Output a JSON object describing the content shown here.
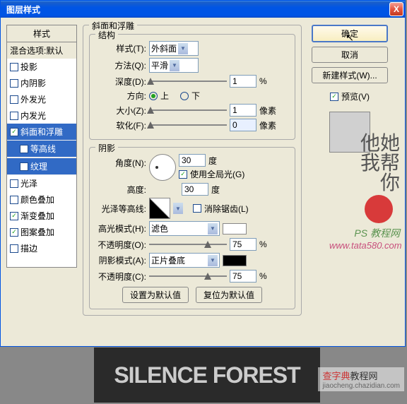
{
  "title": "图层样式",
  "close_x": "X",
  "left": {
    "header": "样式",
    "blend": "混合选项:默认",
    "items": [
      {
        "label": "投影",
        "checked": false,
        "sel": false
      },
      {
        "label": "内阴影",
        "checked": false,
        "sel": false
      },
      {
        "label": "外发光",
        "checked": false,
        "sel": false
      },
      {
        "label": "内发光",
        "checked": false,
        "sel": false
      },
      {
        "label": "斜面和浮雕",
        "checked": true,
        "sel": true
      },
      {
        "label": "等高线",
        "checked": false,
        "sel": false,
        "sub": true,
        "selbg": true
      },
      {
        "label": "纹理",
        "checked": false,
        "sel": false,
        "sub": true,
        "selbg": true
      },
      {
        "label": "光泽",
        "checked": false,
        "sel": false
      },
      {
        "label": "颜色叠加",
        "checked": false,
        "sel": false
      },
      {
        "label": "渐变叠加",
        "checked": true,
        "sel": false
      },
      {
        "label": "图案叠加",
        "checked": true,
        "sel": false
      },
      {
        "label": "描边",
        "checked": false,
        "sel": false
      }
    ]
  },
  "bevel": {
    "section_title": "斜面和浮雕",
    "structure": "结构",
    "style_label": "样式(T):",
    "style_value": "外斜面",
    "technique_label": "方法(Q):",
    "technique_value": "平滑",
    "depth_label": "深度(D):",
    "depth_value": "1",
    "depth_unit": "%",
    "direction_label": "方向:",
    "dir_up": "上",
    "dir_down": "下",
    "size_label": "大小(Z):",
    "size_value": "1",
    "size_unit": "像素",
    "soften_label": "软化(F):",
    "soften_value": "0",
    "soften_unit": "像素"
  },
  "shadow": {
    "section_title": "阴影",
    "angle_label": "角度(N):",
    "angle_value": "30",
    "angle_unit": "度",
    "global_light": "使用全局光(G)",
    "altitude_label": "高度:",
    "altitude_value": "30",
    "altitude_unit": "度",
    "gloss_label": "光泽等高线:",
    "antialias": "消除锯齿(L)",
    "highlight_mode_label": "高光模式(H):",
    "highlight_mode_value": "滤色",
    "hl_opacity_label": "不透明度(O):",
    "hl_opacity_value": "75",
    "hl_opacity_unit": "%",
    "shadow_mode_label": "阴影模式(A):",
    "shadow_mode_value": "正片叠底",
    "sh_opacity_label": "不透明度(C):",
    "sh_opacity_value": "75",
    "sh_opacity_unit": "%",
    "set_default": "设置为默认值",
    "reset_default": "复位为默认值"
  },
  "right": {
    "ok": "确定",
    "cancel": "取消",
    "new_style": "新建样式(W)...",
    "preview": "预览(V)"
  },
  "watermark": {
    "cal1": "他她",
    "cal2": "我帮",
    "cal3": "你",
    "txt1": "PS 教程网",
    "txt2": "www.tata580.com"
  },
  "wm2a": "查字典",
  "wm2b": "教程网",
  "wm2url": "jiaocheng.chazidian.com",
  "bottom_text": "SILENCE FOREST",
  "check": "✓",
  "chev": "▼"
}
